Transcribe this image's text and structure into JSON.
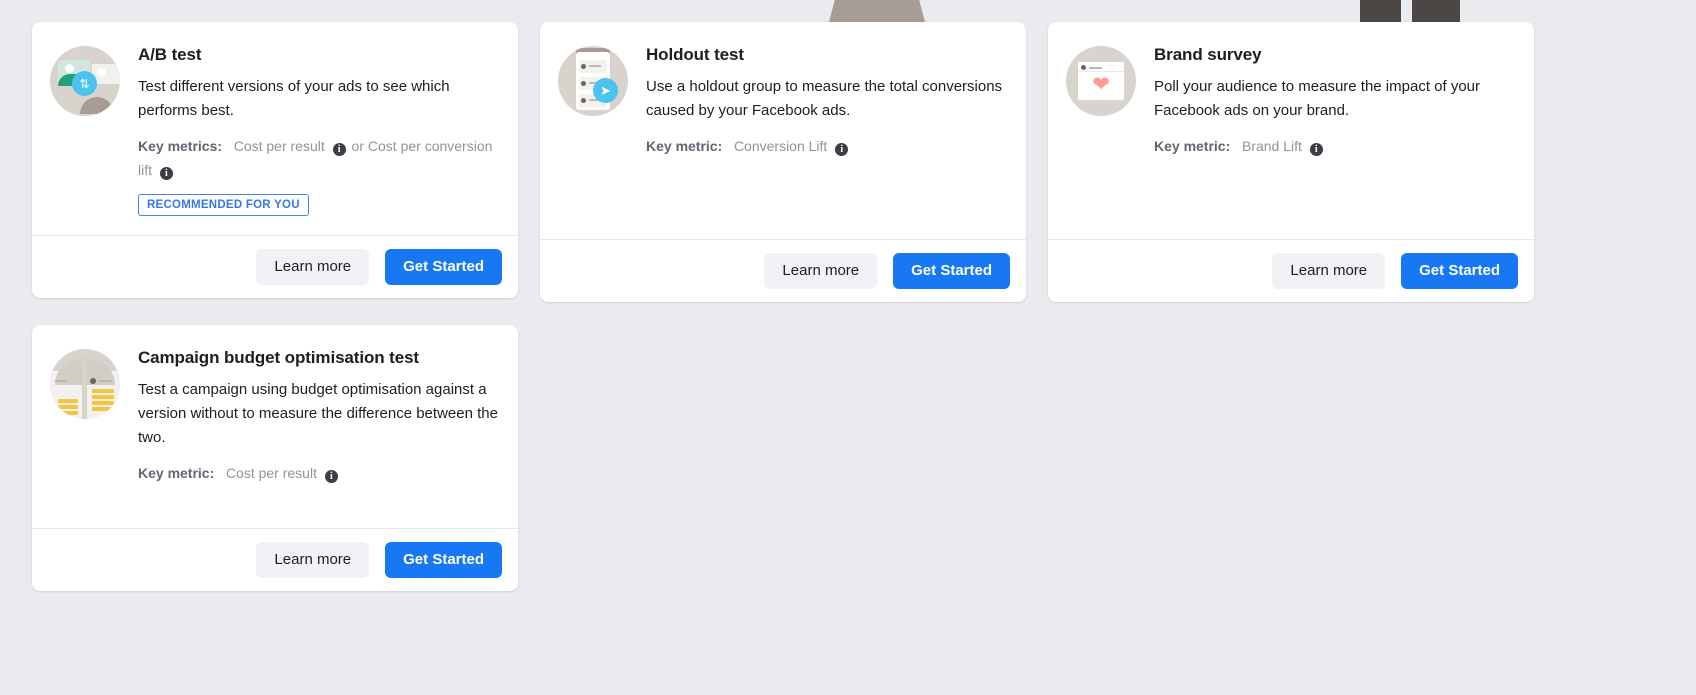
{
  "background": {
    "page_color": "#e9ebee",
    "fragments": [
      "tan-shape",
      "dark-leg-left",
      "dark-leg-right"
    ]
  },
  "theme": {
    "primary_button": "#1877f2",
    "secondary_button": "#f0f2f5",
    "badge_border": "#4a7fe8",
    "badge_text": "#3578e5",
    "card_background": "#ffffff",
    "muted_text": "#8d949e"
  },
  "common": {
    "learn_more_label": "Learn more",
    "get_started_label": "Get Started",
    "info_icon_glyph": "i"
  },
  "cards": [
    {
      "id": "ab-test",
      "icon": "ab-test-icon",
      "title": "A/B test",
      "description": "Test different versions of your ads to see which performs best.",
      "metric_label": "Key metrics:",
      "metric_value": "Cost per result",
      "metric_separator": "or",
      "metric_value_2": "Cost per conversion lift",
      "badge": "RECOMMENDED FOR YOU",
      "learn_more_label": "Learn more",
      "get_started_label": "Get Started"
    },
    {
      "id": "holdout-test",
      "icon": "holdout-test-icon",
      "title": "Holdout test",
      "description": "Use a holdout group to measure the total conversions caused by your Facebook ads.",
      "metric_label": "Key metric:",
      "metric_value": "Conversion Lift",
      "learn_more_label": "Learn more",
      "get_started_label": "Get Started"
    },
    {
      "id": "brand-survey",
      "icon": "brand-survey-icon",
      "title": "Brand survey",
      "description": "Poll your audience to measure the impact of your Facebook ads on your brand.",
      "metric_label": "Key metric:",
      "metric_value": "Brand Lift",
      "learn_more_label": "Learn more",
      "get_started_label": "Get Started"
    },
    {
      "id": "campaign-budget-optimisation-test",
      "icon": "campaign-budget-optimisation-icon",
      "title": "Campaign budget optimisation test",
      "description": "Test a campaign using budget optimisation against a version without to measure the difference between the two.",
      "metric_label": "Key metric:",
      "metric_value": "Cost per result",
      "learn_more_label": "Learn more",
      "get_started_label": "Get Started"
    }
  ]
}
